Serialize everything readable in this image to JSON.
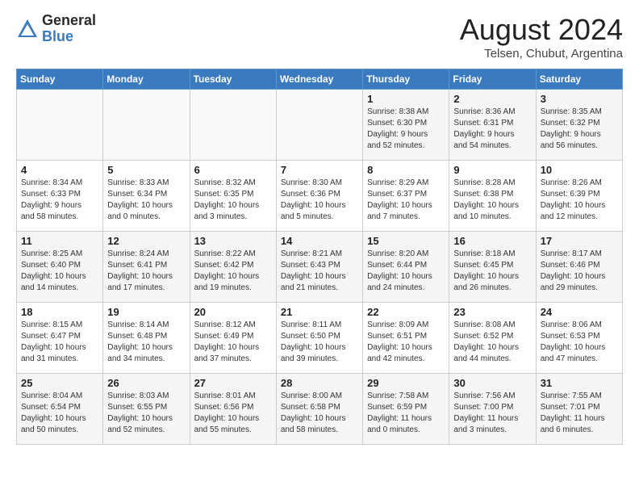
{
  "header": {
    "logo_line1": "General",
    "logo_line2": "Blue",
    "month_year": "August 2024",
    "location": "Telsen, Chubut, Argentina"
  },
  "weekdays": [
    "Sunday",
    "Monday",
    "Tuesday",
    "Wednesday",
    "Thursday",
    "Friday",
    "Saturday"
  ],
  "weeks": [
    [
      {
        "day": "",
        "info": ""
      },
      {
        "day": "",
        "info": ""
      },
      {
        "day": "",
        "info": ""
      },
      {
        "day": "",
        "info": ""
      },
      {
        "day": "1",
        "info": "Sunrise: 8:38 AM\nSunset: 6:30 PM\nDaylight: 9 hours\nand 52 minutes."
      },
      {
        "day": "2",
        "info": "Sunrise: 8:36 AM\nSunset: 6:31 PM\nDaylight: 9 hours\nand 54 minutes."
      },
      {
        "day": "3",
        "info": "Sunrise: 8:35 AM\nSunset: 6:32 PM\nDaylight: 9 hours\nand 56 minutes."
      }
    ],
    [
      {
        "day": "4",
        "info": "Sunrise: 8:34 AM\nSunset: 6:33 PM\nDaylight: 9 hours\nand 58 minutes."
      },
      {
        "day": "5",
        "info": "Sunrise: 8:33 AM\nSunset: 6:34 PM\nDaylight: 10 hours\nand 0 minutes."
      },
      {
        "day": "6",
        "info": "Sunrise: 8:32 AM\nSunset: 6:35 PM\nDaylight: 10 hours\nand 3 minutes."
      },
      {
        "day": "7",
        "info": "Sunrise: 8:30 AM\nSunset: 6:36 PM\nDaylight: 10 hours\nand 5 minutes."
      },
      {
        "day": "8",
        "info": "Sunrise: 8:29 AM\nSunset: 6:37 PM\nDaylight: 10 hours\nand 7 minutes."
      },
      {
        "day": "9",
        "info": "Sunrise: 8:28 AM\nSunset: 6:38 PM\nDaylight: 10 hours\nand 10 minutes."
      },
      {
        "day": "10",
        "info": "Sunrise: 8:26 AM\nSunset: 6:39 PM\nDaylight: 10 hours\nand 12 minutes."
      }
    ],
    [
      {
        "day": "11",
        "info": "Sunrise: 8:25 AM\nSunset: 6:40 PM\nDaylight: 10 hours\nand 14 minutes."
      },
      {
        "day": "12",
        "info": "Sunrise: 8:24 AM\nSunset: 6:41 PM\nDaylight: 10 hours\nand 17 minutes."
      },
      {
        "day": "13",
        "info": "Sunrise: 8:22 AM\nSunset: 6:42 PM\nDaylight: 10 hours\nand 19 minutes."
      },
      {
        "day": "14",
        "info": "Sunrise: 8:21 AM\nSunset: 6:43 PM\nDaylight: 10 hours\nand 21 minutes."
      },
      {
        "day": "15",
        "info": "Sunrise: 8:20 AM\nSunset: 6:44 PM\nDaylight: 10 hours\nand 24 minutes."
      },
      {
        "day": "16",
        "info": "Sunrise: 8:18 AM\nSunset: 6:45 PM\nDaylight: 10 hours\nand 26 minutes."
      },
      {
        "day": "17",
        "info": "Sunrise: 8:17 AM\nSunset: 6:46 PM\nDaylight: 10 hours\nand 29 minutes."
      }
    ],
    [
      {
        "day": "18",
        "info": "Sunrise: 8:15 AM\nSunset: 6:47 PM\nDaylight: 10 hours\nand 31 minutes."
      },
      {
        "day": "19",
        "info": "Sunrise: 8:14 AM\nSunset: 6:48 PM\nDaylight: 10 hours\nand 34 minutes."
      },
      {
        "day": "20",
        "info": "Sunrise: 8:12 AM\nSunset: 6:49 PM\nDaylight: 10 hours\nand 37 minutes."
      },
      {
        "day": "21",
        "info": "Sunrise: 8:11 AM\nSunset: 6:50 PM\nDaylight: 10 hours\nand 39 minutes."
      },
      {
        "day": "22",
        "info": "Sunrise: 8:09 AM\nSunset: 6:51 PM\nDaylight: 10 hours\nand 42 minutes."
      },
      {
        "day": "23",
        "info": "Sunrise: 8:08 AM\nSunset: 6:52 PM\nDaylight: 10 hours\nand 44 minutes."
      },
      {
        "day": "24",
        "info": "Sunrise: 8:06 AM\nSunset: 6:53 PM\nDaylight: 10 hours\nand 47 minutes."
      }
    ],
    [
      {
        "day": "25",
        "info": "Sunrise: 8:04 AM\nSunset: 6:54 PM\nDaylight: 10 hours\nand 50 minutes."
      },
      {
        "day": "26",
        "info": "Sunrise: 8:03 AM\nSunset: 6:55 PM\nDaylight: 10 hours\nand 52 minutes."
      },
      {
        "day": "27",
        "info": "Sunrise: 8:01 AM\nSunset: 6:56 PM\nDaylight: 10 hours\nand 55 minutes."
      },
      {
        "day": "28",
        "info": "Sunrise: 8:00 AM\nSunset: 6:58 PM\nDaylight: 10 hours\nand 58 minutes."
      },
      {
        "day": "29",
        "info": "Sunrise: 7:58 AM\nSunset: 6:59 PM\nDaylight: 11 hours\nand 0 minutes."
      },
      {
        "day": "30",
        "info": "Sunrise: 7:56 AM\nSunset: 7:00 PM\nDaylight: 11 hours\nand 3 minutes."
      },
      {
        "day": "31",
        "info": "Sunrise: 7:55 AM\nSunset: 7:01 PM\nDaylight: 11 hours\nand 6 minutes."
      }
    ]
  ]
}
